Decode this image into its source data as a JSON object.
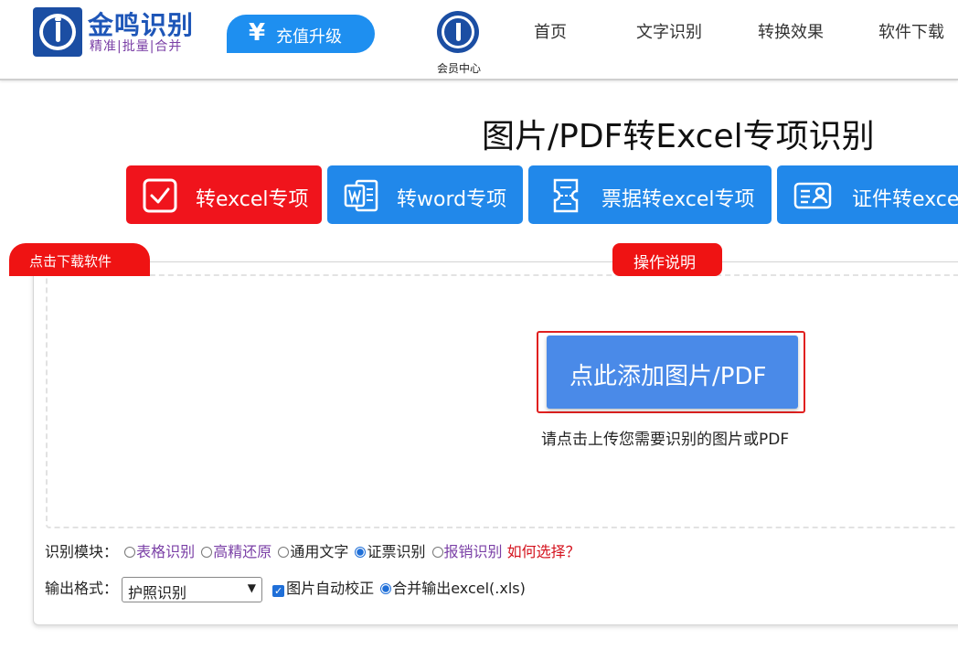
{
  "header": {
    "logo_title": "金鸣识别",
    "logo_subtitle": "精准|批量|合并",
    "recharge_icon": "¥",
    "recharge_label": "充值升级",
    "member_label": "会员中心",
    "nav": [
      "首页",
      "文字识别",
      "转换效果",
      "软件下载"
    ]
  },
  "page_title": "图片/PDF转Excel专项识别",
  "tabs": [
    {
      "label": "转excel专项",
      "icon": "check-icon",
      "color": "#f0141c"
    },
    {
      "label": "转word专项",
      "icon": "word-icon",
      "color": "#2188ea"
    },
    {
      "label": "票据转excel专项",
      "icon": "ticket-icon",
      "color": "#2188ea"
    },
    {
      "label": "证件转excel",
      "icon": "id-card-icon",
      "color": "#2188ea"
    }
  ],
  "download_badge": "点击下载软件",
  "help_badge": "操作说明",
  "upload": {
    "button_label": "点此添加图片/PDF",
    "hint": "请点击上传您需要识别的图片或PDF"
  },
  "recognition_module": {
    "label": "识别模块：",
    "options": [
      {
        "label": "表格识别",
        "selected": false
      },
      {
        "label": "高精还原",
        "selected": false
      },
      {
        "label": "通用文字",
        "selected": false
      },
      {
        "label": "证票识别",
        "selected": true
      },
      {
        "label": "报销识别",
        "selected": false
      }
    ],
    "how_to_choose": "如何选择？"
  },
  "output": {
    "label": "输出格式：",
    "select_value": "护照识别",
    "auto_correct_label": "图片自动校正",
    "auto_correct_checked": true,
    "merge_label": "合并输出excel(.xls)",
    "merge_selected": true
  },
  "colors": {
    "accent_red": "#ef1313",
    "accent_blue": "#2188ea",
    "upload_blue": "#4a8ae8"
  }
}
